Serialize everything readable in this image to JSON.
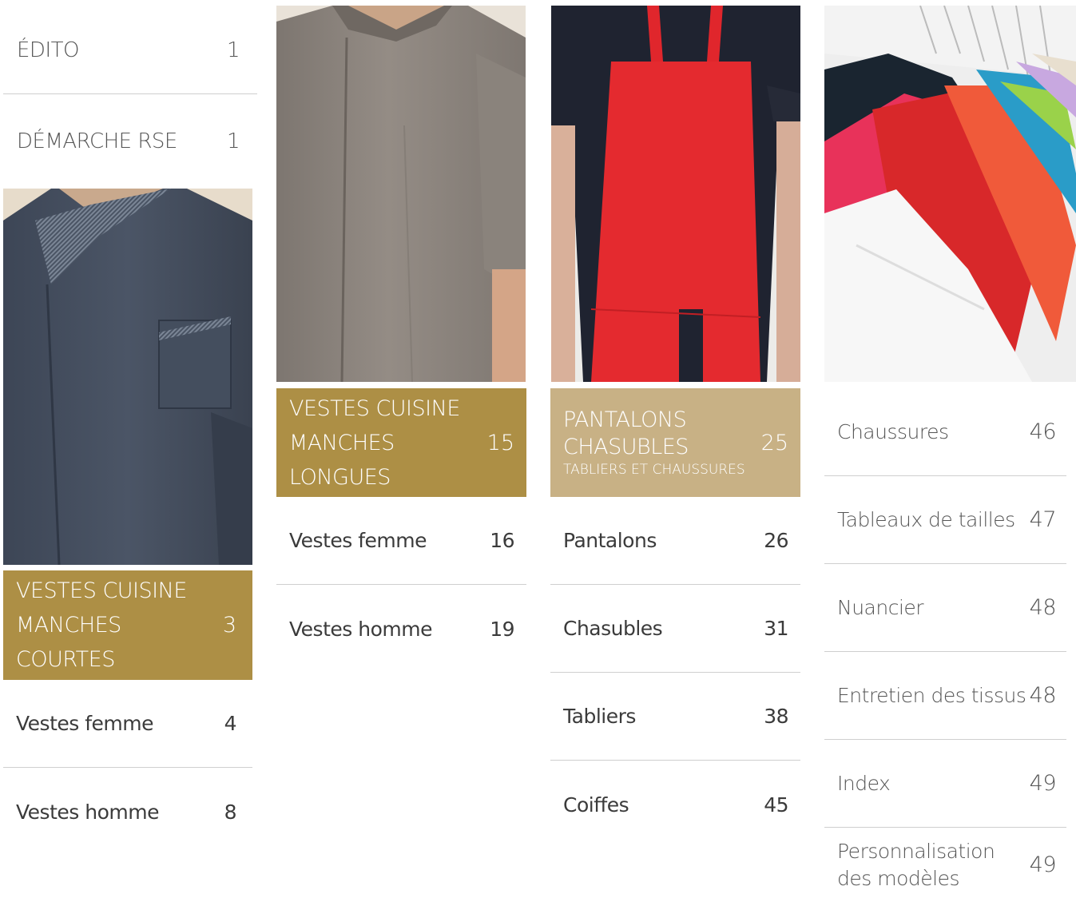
{
  "colors": {
    "banner_gold": "#ad8f45",
    "banner_gold_light": "#c8b185",
    "divider": "#cfcfcf"
  },
  "col1": {
    "top_items": [
      {
        "label": "ÉDITO",
        "page": "1"
      },
      {
        "label": "DÉMARCHE RSE",
        "page": "1"
      }
    ],
    "section": {
      "line1": "VESTES CUISINE",
      "line2": "MANCHES COURTES",
      "page": "3"
    },
    "items": [
      {
        "label": "Vestes femme",
        "page": "4"
      },
      {
        "label": "Vestes homme",
        "page": "8"
      }
    ]
  },
  "col2": {
    "section": {
      "line1": "VESTES CUISINE",
      "line2": "MANCHES LONGUES",
      "page": "15"
    },
    "items": [
      {
        "label": "Vestes femme",
        "page": "16"
      },
      {
        "label": "Vestes homme",
        "page": "19"
      }
    ]
  },
  "col3": {
    "section": {
      "line1": "PANTALONS",
      "line2": "CHASUBLES",
      "sub": "TABLIERS ET CHAUSSURES",
      "page": "25"
    },
    "items": [
      {
        "label": "Pantalons",
        "page": "26"
      },
      {
        "label": "Chasubles",
        "page": "31"
      },
      {
        "label": "Tabliers",
        "page": "38"
      },
      {
        "label": "Coiffes",
        "page": "45"
      }
    ]
  },
  "col4": {
    "items": [
      {
        "label": "Chaussures",
        "page": "46"
      },
      {
        "label": "Tableaux de tailles",
        "page": "47"
      },
      {
        "label": "Nuancier",
        "page": "48"
      },
      {
        "label": "Entretien des tissus",
        "page": "48"
      },
      {
        "label": "Index",
        "page": "49"
      },
      {
        "label": "Personnalisation",
        "label2": "des modèles",
        "page": "49"
      }
    ]
  }
}
